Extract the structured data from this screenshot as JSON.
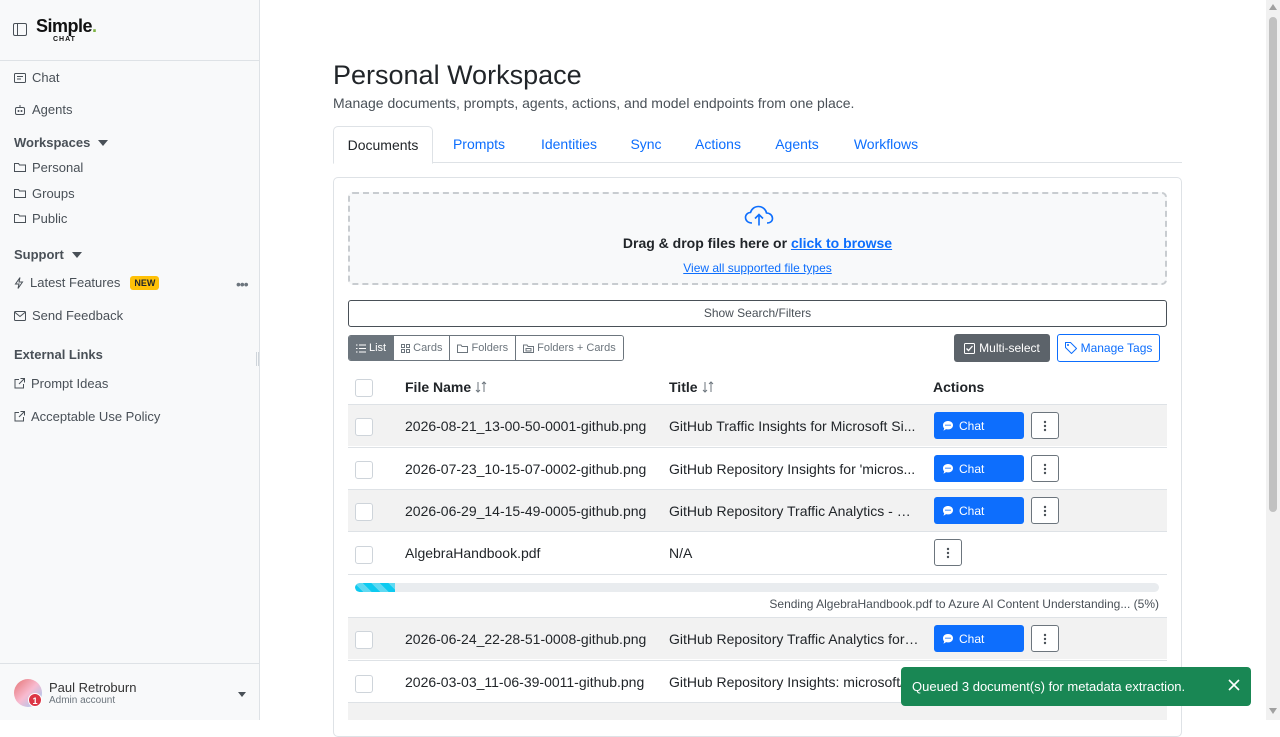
{
  "sidebar": {
    "logo_main": "Simple",
    "logo_sub": "CHAT",
    "nav": [
      {
        "label": "Chat",
        "icon": "chat-icon"
      },
      {
        "label": "Agents",
        "icon": "robot-icon"
      }
    ],
    "workspaces": {
      "heading": "Workspaces",
      "items": [
        {
          "label": "Personal",
          "icon": "folder-icon"
        },
        {
          "label": "Groups",
          "icon": "folder-icon"
        },
        {
          "label": "Public",
          "icon": "folder-icon"
        }
      ]
    },
    "support": {
      "heading": "Support",
      "latest_features": "Latest Features",
      "new_badge": "NEW",
      "send_feedback": "Send Feedback"
    },
    "external": {
      "heading": "External Links",
      "items": [
        {
          "label": "Prompt Ideas",
          "icon": "external-link-icon"
        },
        {
          "label": "Acceptable Use Policy",
          "icon": "external-link-icon"
        }
      ]
    },
    "user": {
      "name": "Paul Retroburn",
      "role": "Admin account",
      "notifications": "1"
    }
  },
  "main": {
    "title": "Personal Workspace",
    "subtitle": "Manage documents, prompts, agents, actions, and model endpoints from one place.",
    "tabs": [
      {
        "label": "Documents"
      },
      {
        "label": "Prompts"
      },
      {
        "label": "Identities"
      },
      {
        "label": "Sync"
      },
      {
        "label": "Actions"
      },
      {
        "label": "Agents"
      },
      {
        "label": "Workflows"
      }
    ],
    "active_tab": "Documents",
    "upload": {
      "text_before": "Drag & drop files here or ",
      "browse_link": "click to browse",
      "types_link": "View all supported file types"
    },
    "filters_button": "Show Search/Filters",
    "views": [
      {
        "label": "List",
        "icon": "list-icon"
      },
      {
        "label": "Cards",
        "icon": "grid-icon"
      },
      {
        "label": "Folders",
        "icon": "folder-icon"
      },
      {
        "label": "Folders + Cards",
        "icon": "folder-cards-icon"
      }
    ],
    "active_view": "List",
    "multi_select": "Multi-select",
    "manage_tags": "Manage Tags",
    "table": {
      "headers": {
        "file_name": "File Name",
        "title": "Title",
        "actions": "Actions"
      },
      "chat_label": "Chat",
      "rows": [
        {
          "file_name": "2026-08-21_13-00-50-0001-github.png",
          "title": "GitHub Traffic Insights for Microsoft Si...",
          "chat": true
        },
        {
          "file_name": "2026-07-23_10-15-07-0002-github.png",
          "title": "GitHub Repository Insights for 'micros...",
          "chat": true
        },
        {
          "file_name": "2026-06-29_14-15-49-0005-github.png",
          "title": "GitHub Repository Traffic Analytics - M...",
          "chat": true
        },
        {
          "file_name": "AlgebraHandbook.pdf",
          "title": "N/A",
          "chat": false
        },
        {
          "file_name": "2026-06-24_22-28-51-0008-github.png",
          "title": "GitHub Repository Traffic Analytics for ...",
          "chat": true
        },
        {
          "file_name": "2026-03-03_11-06-39-0011-github.png",
          "title": "GitHub Repository Insights: microsoft/",
          "chat": true
        }
      ],
      "progress": {
        "text": "Sending AlgebraHandbook.pdf to Azure AI Content Understanding... (5%)",
        "percent": 5
      }
    }
  },
  "toast": {
    "message": "Queued 3 document(s) for metadata extraction."
  },
  "colors": {
    "primary": "#0d6efd",
    "success": "#198754",
    "badge": "#ffc107",
    "progress": "#0dcaf0"
  }
}
